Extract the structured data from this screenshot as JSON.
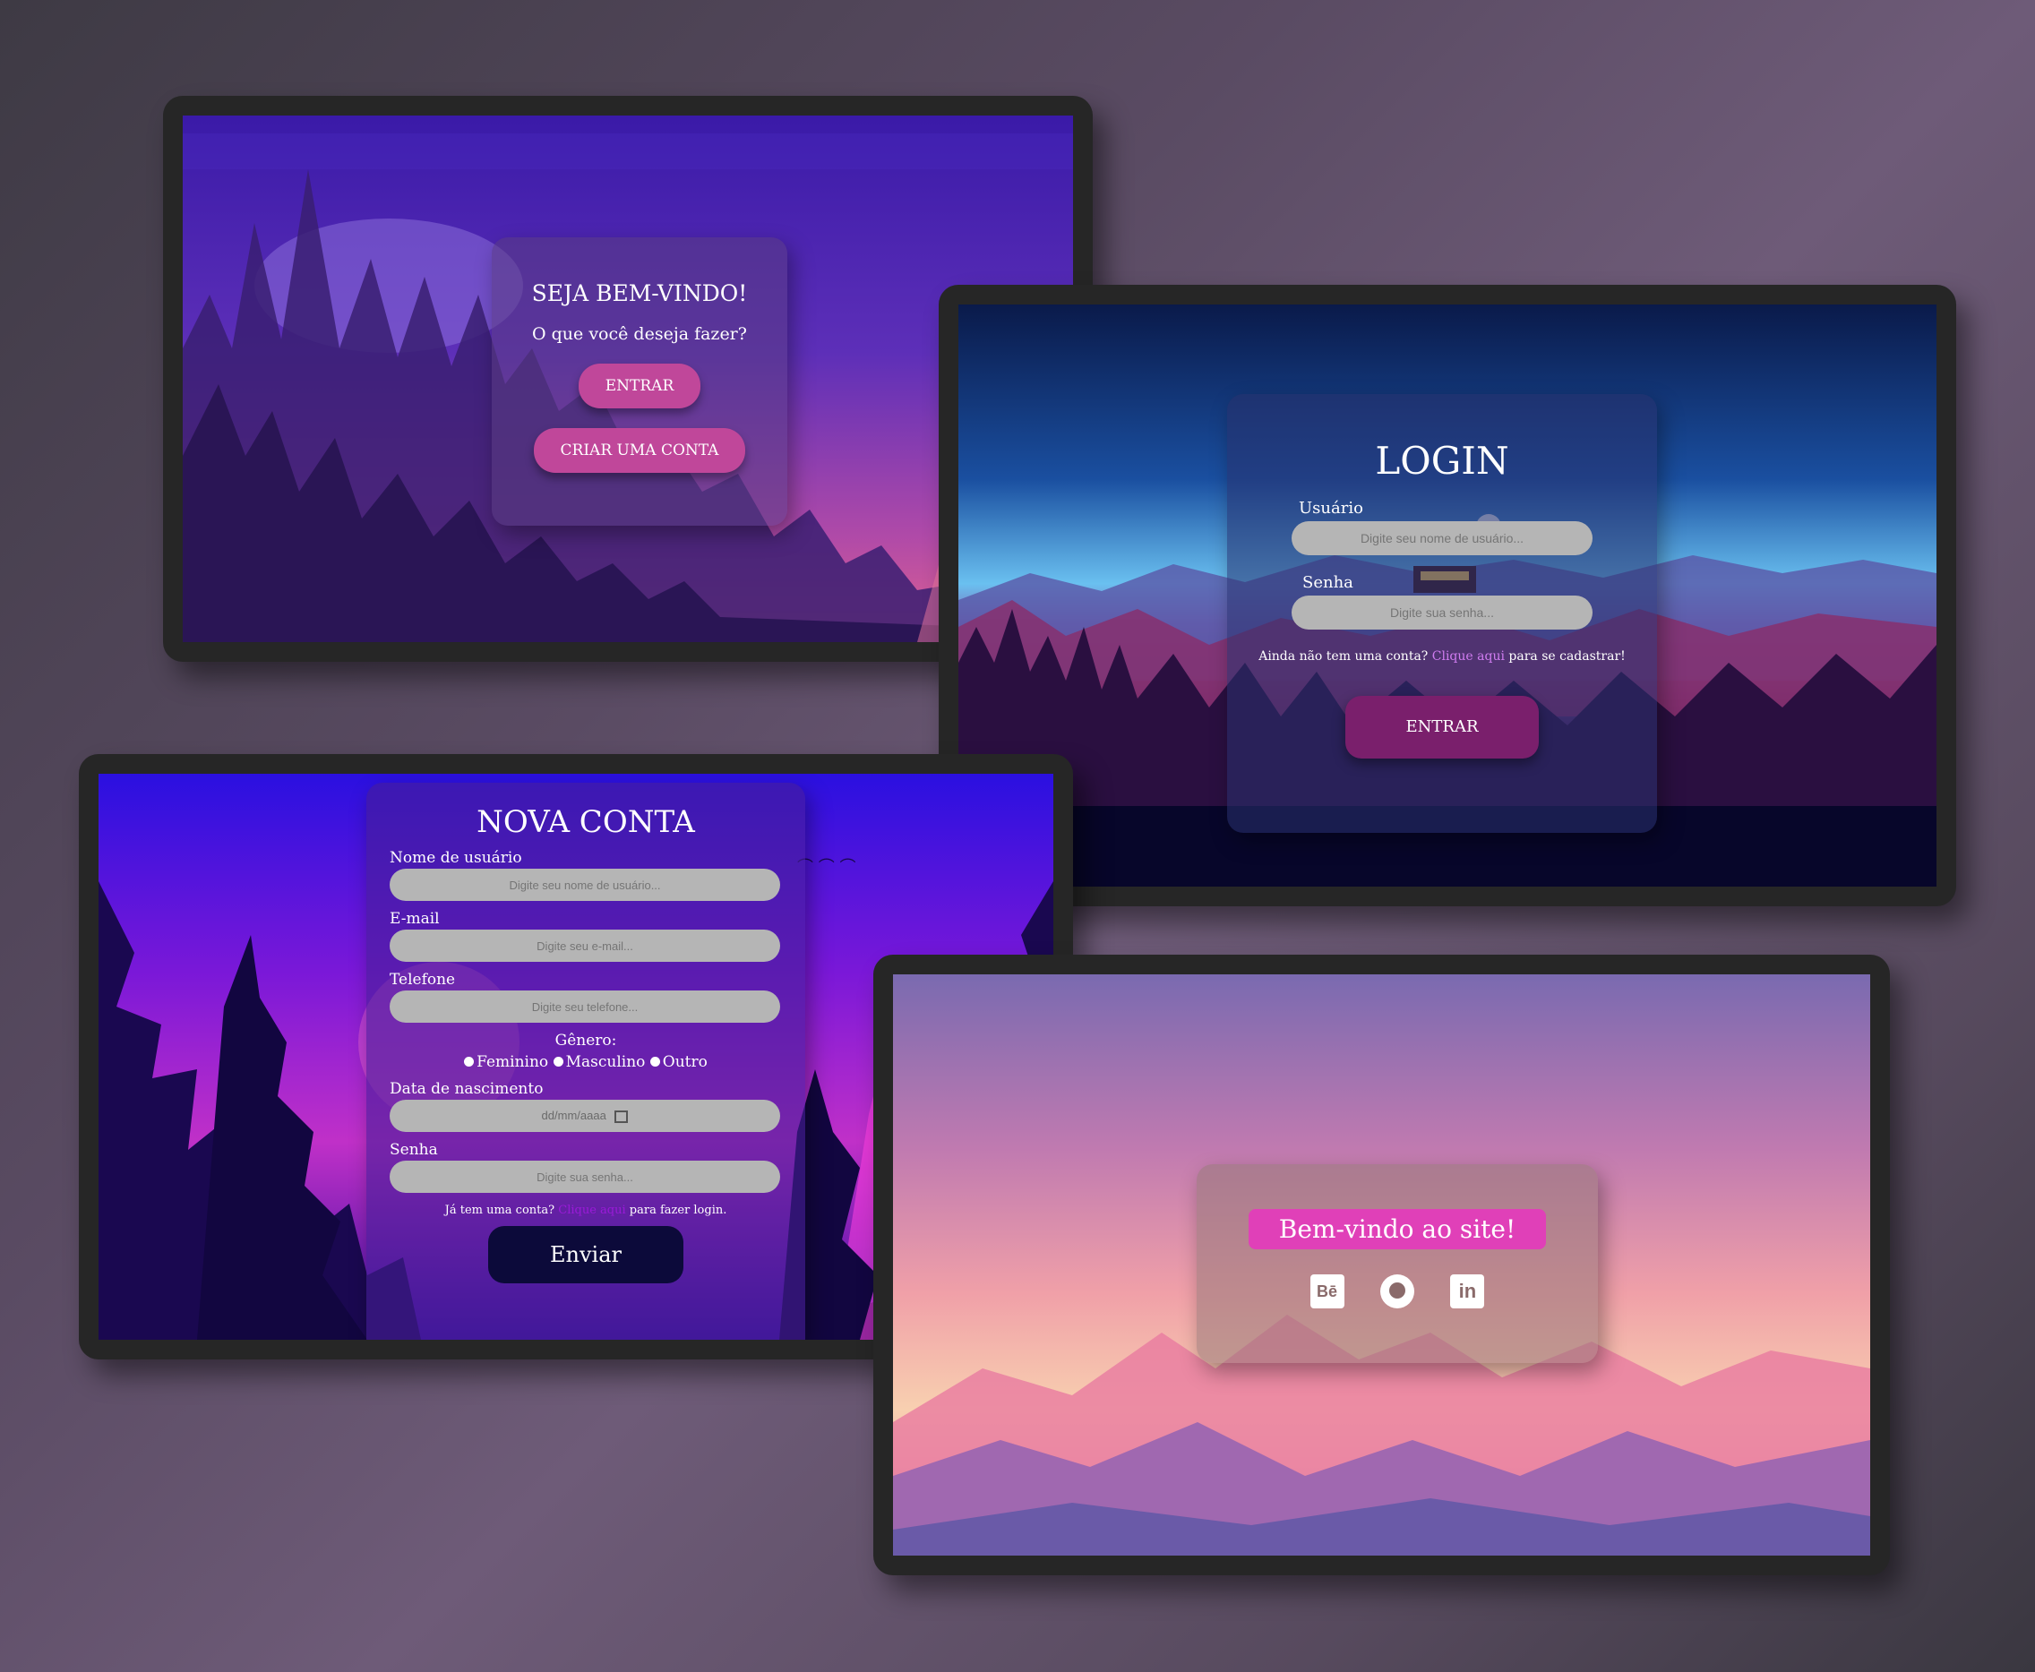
{
  "welcome_screen": {
    "title": "SEJA BEM-VINDO!",
    "subtitle": "O que você deseja fazer?",
    "enter_button": "ENTRAR",
    "create_account_button": "CRIAR UMA CONTA"
  },
  "login_screen": {
    "title": "LOGIN",
    "user_label": "Usuário",
    "user_placeholder": "Digite seu nome de usuário...",
    "password_label": "Senha",
    "password_placeholder": "Digite sua senha...",
    "signup_prefix": "Ainda não tem uma conta?",
    "signup_link": "Clique aqui",
    "signup_suffix": "para se cadastrar!",
    "enter_button": "ENTRAR"
  },
  "signup_screen": {
    "title": "NOVA CONTA",
    "username_label": "Nome de usuário",
    "username_placeholder": "Digite seu nome de usuário...",
    "email_label": "E-mail",
    "email_placeholder": "Digite seu e-mail...",
    "phone_label": "Telefone",
    "phone_placeholder": "Digite seu telefone...",
    "gender_label": "Gênero:",
    "gender_options": [
      "Feminino",
      "Masculino",
      "Outro"
    ],
    "birthdate_label": "Data de nascimento",
    "birthdate_placeholder": "dd/mm/aaaa",
    "password_label": "Senha",
    "password_placeholder": "Digite sua senha...",
    "login_prefix": "Já tem uma conta?",
    "login_link": "Clique aqui",
    "login_suffix": "para fazer login.",
    "submit_button": "Enviar"
  },
  "home_screen": {
    "greeting": "Bem-vindo ao site!",
    "social_icons": [
      "behance-icon",
      "github-icon",
      "linkedin-icon"
    ],
    "behance_glyph": "Bē",
    "linkedin_glyph": "in"
  },
  "colors": {
    "accent_pink": "#c0479a",
    "greeting_pink": "#e040b8",
    "link_purple": "#d07cf0",
    "login_button": "#7a1f6c",
    "submit_button": "#0c0a3a",
    "frame": "#262626"
  }
}
